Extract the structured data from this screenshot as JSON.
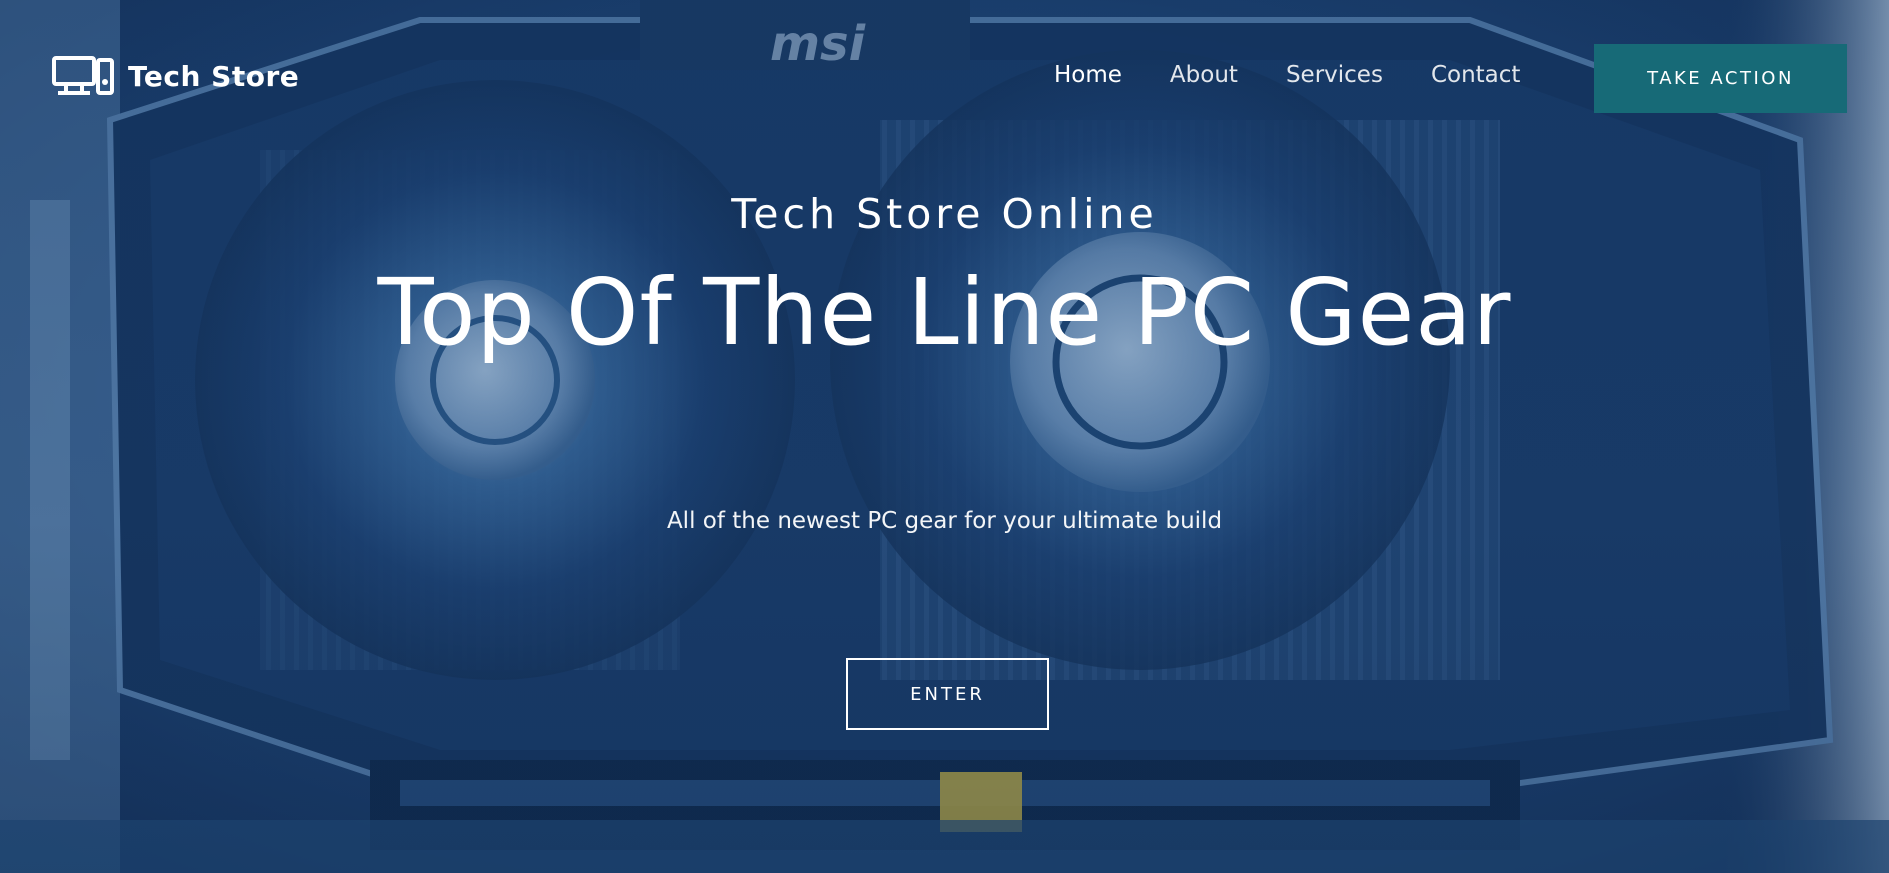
{
  "brand": {
    "name": "Tech Store",
    "logo_icon": "computer-monitor-icon"
  },
  "nav": {
    "items": [
      {
        "label": "Home"
      },
      {
        "label": "About"
      },
      {
        "label": "Services"
      },
      {
        "label": "Contact"
      }
    ],
    "cta_label": "TAKE ACTION"
  },
  "hero": {
    "tagline": "Tech Store Online",
    "headline": "Top Of The Line PC Gear",
    "subtitle": "All of the newest PC gear for your ultimate build",
    "button_label": "ENTER",
    "background": "graphics-card-photo"
  },
  "colors": {
    "cta_background": "#176a77",
    "overlay_tint": "#0e2c56",
    "text": "#ffffff"
  }
}
